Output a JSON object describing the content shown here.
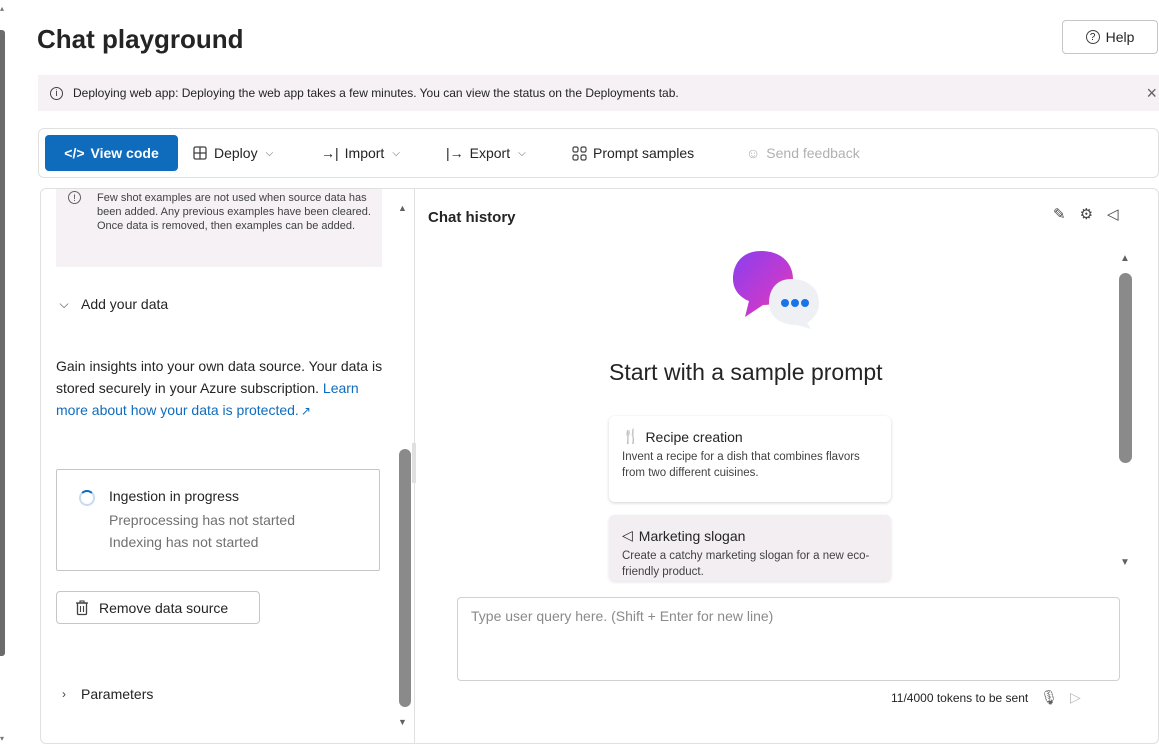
{
  "page": {
    "title": "Chat playground",
    "help_label": "Help"
  },
  "banner": {
    "text": "Deploying web app: Deploying the web app takes a few minutes. You can view the status on the Deployments tab."
  },
  "toolbar": {
    "view_code": "View code",
    "deploy": "Deploy",
    "import": "Import",
    "export": "Export",
    "prompt_samples": "Prompt samples",
    "send_feedback": "Send feedback"
  },
  "setup": {
    "fewshot_note": "Few shot examples are not used when source data has been added. Any previous examples have been cleared. Once data is removed, then examples can be added.",
    "add_data_header": "Add your data",
    "description_text": "Gain insights into your own data source. Your data is stored securely in your Azure subscription. ",
    "description_link": "Learn more about how your data is protected.",
    "ingestion": {
      "title": "Ingestion in progress",
      "line1": "Preprocessing has not started",
      "line2": "Indexing has not started"
    },
    "remove_button": "Remove data source",
    "parameters_header": "Parameters"
  },
  "chat": {
    "history_title": "Chat history",
    "start_title": "Start with a sample prompt",
    "samples": [
      {
        "title": "Recipe creation",
        "description": "Invent a recipe for a dish that combines flavors from two different cuisines."
      },
      {
        "title": "Marketing slogan",
        "description": "Create a catchy marketing slogan for a new eco-friendly product."
      }
    ],
    "input_placeholder": "Type user query here. (Shift + Enter for new line)",
    "token_count": "11/4000 tokens to be sent"
  },
  "icons": {
    "info": "info-icon",
    "close": "close-icon",
    "code": "code-icon",
    "deploy": "deploy-icon",
    "import": "import-icon",
    "export": "export-icon",
    "prompt_samples": "grid-icon",
    "feedback": "feedback-icon",
    "broom": "clear-chat-icon",
    "settings": "gear-icon",
    "speaker": "speaker-icon",
    "microphone": "microphone-icon",
    "send": "send-icon",
    "trash": "trash-icon",
    "spinner": "spinner-icon"
  },
  "colors": {
    "accent": "#0f6cbd",
    "banner_bg": "#f5f1f4"
  }
}
